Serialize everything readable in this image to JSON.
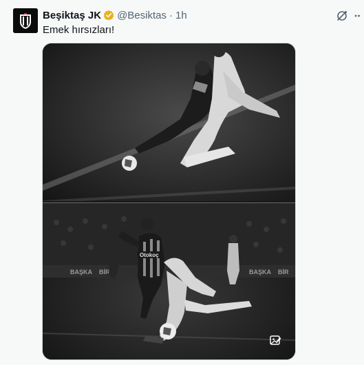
{
  "author": {
    "name": "Beşiktaş JK",
    "handle": "@Besiktas",
    "separator": "·",
    "time": "1h",
    "verified": true,
    "avatar_icon": "besiktas-crest-icon"
  },
  "tweet": {
    "text": "Emek hırsızları!"
  },
  "media": {
    "image_top": {
      "icon": "football-tackle-photo"
    },
    "image_bottom": {
      "icon": "football-tackle-photo",
      "jersey_text": "Otokoç",
      "board_texts": [
        "BAŞKA",
        "BİR",
        "BAŞKA",
        "BİR"
      ]
    },
    "alt_icon": "image-edit-icon"
  },
  "actions": {
    "grok_icon": "grok-icon",
    "more_icon": "more-icon"
  },
  "colors": {
    "background": "#f7f9f9",
    "text_primary": "#0f1419",
    "text_secondary": "#536471",
    "verified_gold": "#e8b21a",
    "media_border": "#cfd9de"
  }
}
